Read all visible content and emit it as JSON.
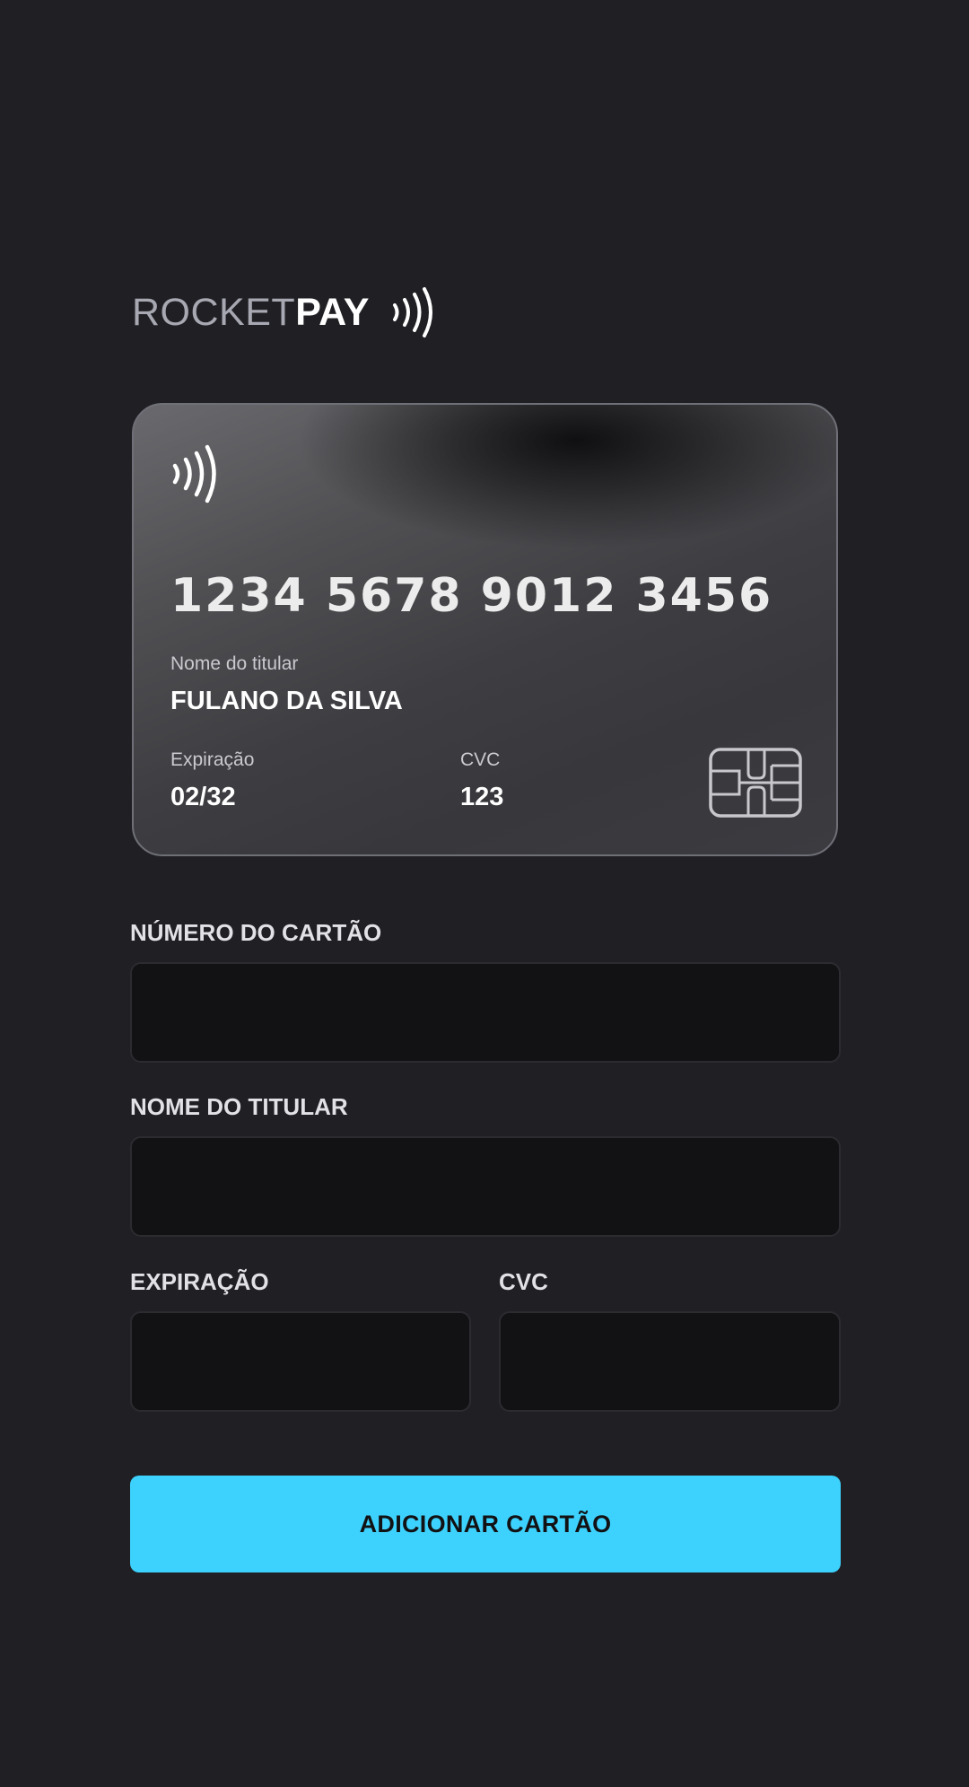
{
  "brand": {
    "name_light": "ROCKET",
    "name_bold": "PAY",
    "icon": "contactless-icon"
  },
  "card": {
    "icon": "contactless-icon",
    "number": "1234 5678 9012 3456",
    "holder_label": "Nome do titular",
    "holder_value": "FULANO DA SILVA",
    "expiration_label": "Expiração",
    "expiration_value": "02/32",
    "cvc_label": "CVC",
    "cvc_value": "123",
    "chip_icon": "card-chip-icon"
  },
  "form": {
    "card_number": {
      "label": "NÚMERO DO CARTÃO",
      "value": "",
      "placeholder": ""
    },
    "holder_name": {
      "label": "NOME DO TITULAR",
      "value": "",
      "placeholder": ""
    },
    "expiration": {
      "label": "EXPIRAÇÃO",
      "value": "",
      "placeholder": ""
    },
    "cvc": {
      "label": "CVC",
      "value": "",
      "placeholder": ""
    },
    "submit_label": "ADICIONAR CARTÃO"
  },
  "colors": {
    "background": "#202024",
    "input_background": "#121214",
    "accent": "#3DD2FD",
    "text": "#E1E1E6",
    "logo_light": "#A8A8B3"
  }
}
